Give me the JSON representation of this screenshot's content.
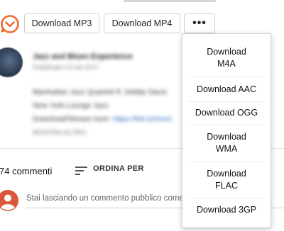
{
  "toolbar": {
    "logo_icon": "orange-download-logo-icon",
    "accent_color": "#ee6a2a",
    "mp3_label": "Download MP3",
    "mp4_label": "Download MP4",
    "more_label": "•••"
  },
  "video": {
    "channel_name": "Jazz and Blues Experience",
    "published": "Pubblicato il 8 set 2017",
    "description_lines": [
      "Manhattan Jazz Quartett ft. Debby Davis",
      "New York Lounge Jazz",
      "Download/Stream here: "
    ],
    "description_link": "https://lnk.to/mnm",
    "show_more": "MOSTRA ALTRO"
  },
  "comments": {
    "count_label": "74 commenti",
    "sort_label": "ORDINA PER",
    "sort_icon": "sort-lines-icon",
    "input_placeholder": "Stai lasciando un commento pubblico come",
    "avatar_icon": "user-avatar-icon"
  },
  "download_menu": {
    "items": [
      "Download\nM4A",
      "Download AAC",
      "Download OGG",
      "Download\nWMA",
      "Download\nFLAC",
      "Download 3GP"
    ]
  }
}
